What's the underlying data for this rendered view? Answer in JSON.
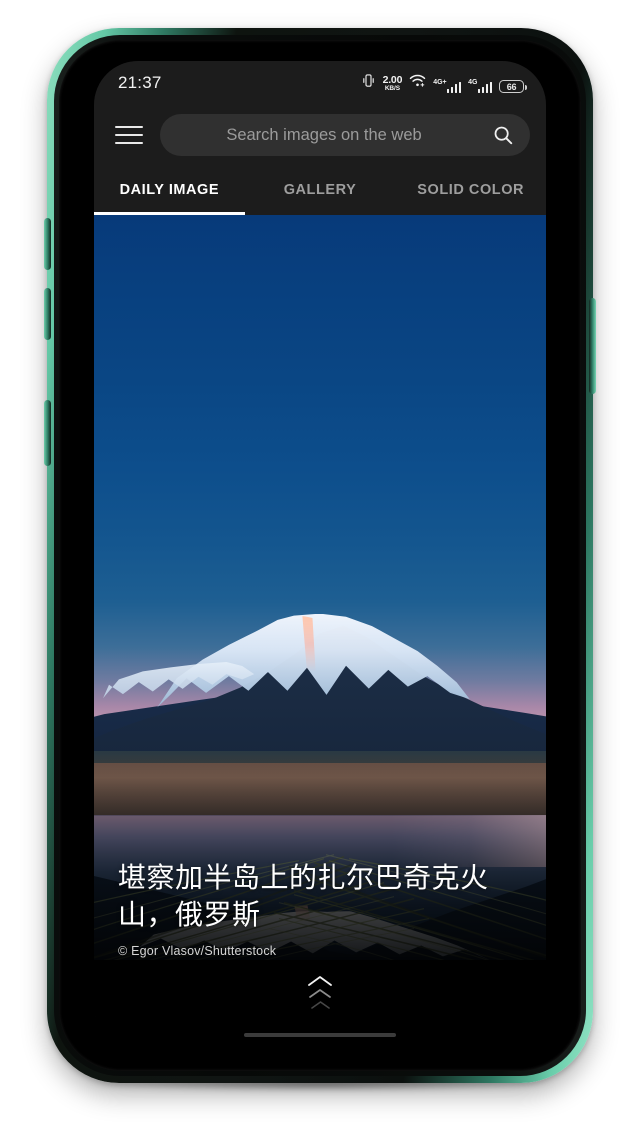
{
  "statusbar": {
    "time": "21:37",
    "network_speed_value": "2.00",
    "network_speed_unit": "KB/S",
    "vibrate_icon": "vibrate-icon",
    "wifi_icon": "wifi-icon",
    "signal1_label": "4G+",
    "signal2_label": "4G",
    "battery_level": "66"
  },
  "appbar": {
    "menu_icon": "hamburger-menu-icon",
    "search_placeholder": "Search images on the web",
    "search_icon": "search-icon"
  },
  "tabs": {
    "items": [
      {
        "label": "DAILY IMAGE",
        "active": true
      },
      {
        "label": "GALLERY",
        "active": false
      },
      {
        "label": "SOLID COLOR",
        "active": false
      }
    ],
    "active_index": 0,
    "indicator_color": "#ffffff"
  },
  "wallpaper": {
    "caption_title": "堪察加半岛上的扎尔巴奇克火山，俄罗斯",
    "caption_credit": "©  Egor Vlasov/Shutterstock",
    "expand_icon": "chevron-double-up-icon",
    "home_indicator": "home-gesture-bar"
  },
  "colors": {
    "chrome_bg": "#1c1c1c",
    "search_field_bg": "#303030",
    "tab_active": "#ffffff",
    "tab_inactive": "#9e9e9e",
    "sky_deep_blue": "#073a7a",
    "horizon_pink": "#c79bb0",
    "phone_frame_green": "#76d6b4"
  }
}
